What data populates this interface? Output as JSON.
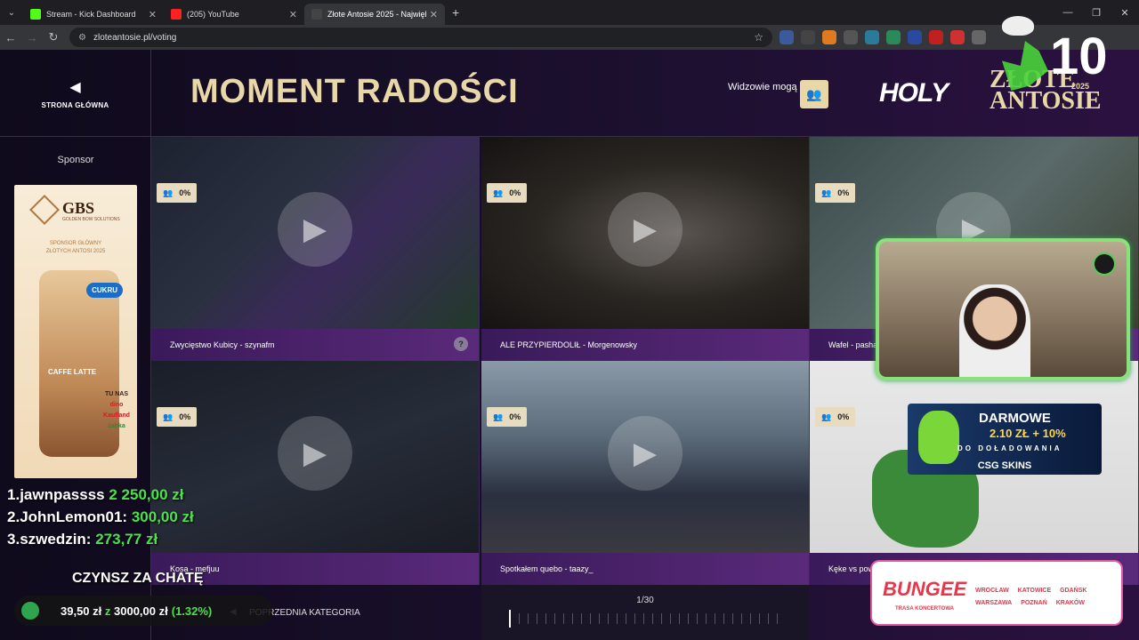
{
  "browser": {
    "tabs": [
      {
        "title": "Stream - Kick Dashboard",
        "color": "#53fc18"
      },
      {
        "title": "(205) YouTube",
        "color": "#ff2020"
      },
      {
        "title": "Złote Antosie 2025 - Najwięks",
        "color": "#444"
      }
    ],
    "url": "zloteantosie.pl/voting",
    "new_tab": "+"
  },
  "header": {
    "back_label": "STRONA GŁÓWNA",
    "title": "MOMENT RADOŚCI",
    "viewers_label": "Widzowie mogą",
    "brand_holy": "HOLY",
    "logo_line1": "ZŁOTE",
    "logo_line2": "ANTOSIE",
    "logo_year": "2025",
    "overlay_number": "10"
  },
  "sidebar": {
    "sponsor_label": "Sponsor",
    "ad": {
      "brand": "GBS",
      "brand_sub": "GOLDEN BOW SOLUTIONS",
      "sponsor_line1": "SPONSOR GŁÓWNY",
      "sponsor_line2": "ZŁOTYCH ANTOSI 2025",
      "cukru": "CUKRU",
      "flavor": "CAFFE LATTE",
      "stores": [
        "TU NAS",
        "dino",
        "Kaufland",
        "żabka"
      ]
    }
  },
  "clips": [
    {
      "caption": "Zwycięstwo Kubicy - szynafm",
      "percent": "0%",
      "help": "?"
    },
    {
      "caption": "ALE PRZYPIERDOLIŁ - Morgenowsky",
      "percent": "0%"
    },
    {
      "caption": "Wafel - pasha",
      "percent": "0%"
    },
    {
      "caption": "Kosa - mefjuu",
      "percent": "0%"
    },
    {
      "caption": "Spotkałem quebo - taazy_",
      "percent": "0%"
    },
    {
      "caption": "Kęke vs pow",
      "percent": "0%"
    }
  ],
  "navigation": {
    "prev_category": "POPRZEDNIA KATEGORIA",
    "page": "1/30"
  },
  "stream_overlay": {
    "leaderboard": [
      {
        "rank": "1.",
        "name": "jawnpassss",
        "amount": "2 250,00 zł"
      },
      {
        "rank": "2.",
        "name": "JohnLemon01:",
        "amount": "300,00 zł"
      },
      {
        "rank": "3.",
        "name": "szwedzin:",
        "amount": "273,77 zł"
      }
    ],
    "rent_label": "CZYNSZ ZA CHATĘ",
    "goal_current": "39,50 zł",
    "goal_of": "z",
    "goal_target": "3000,00 zł",
    "goal_percent": "(1.32%)",
    "goal_fraction": 0.0132,
    "csg": {
      "headline": "DARMOWE",
      "amount": "2.10 ZŁ + 10%",
      "sub": "DO DOŁADOWANIA",
      "brand": "CSG SKINS"
    },
    "bungee": {
      "name": "BUNGEE",
      "sub": "TRASA KONCERTOWA",
      "cities": [
        "WROCŁAW",
        "KATOWICE",
        "GDAŃSK",
        "WARSZAWA",
        "POZNAŃ",
        "KRAKÓW"
      ]
    }
  }
}
